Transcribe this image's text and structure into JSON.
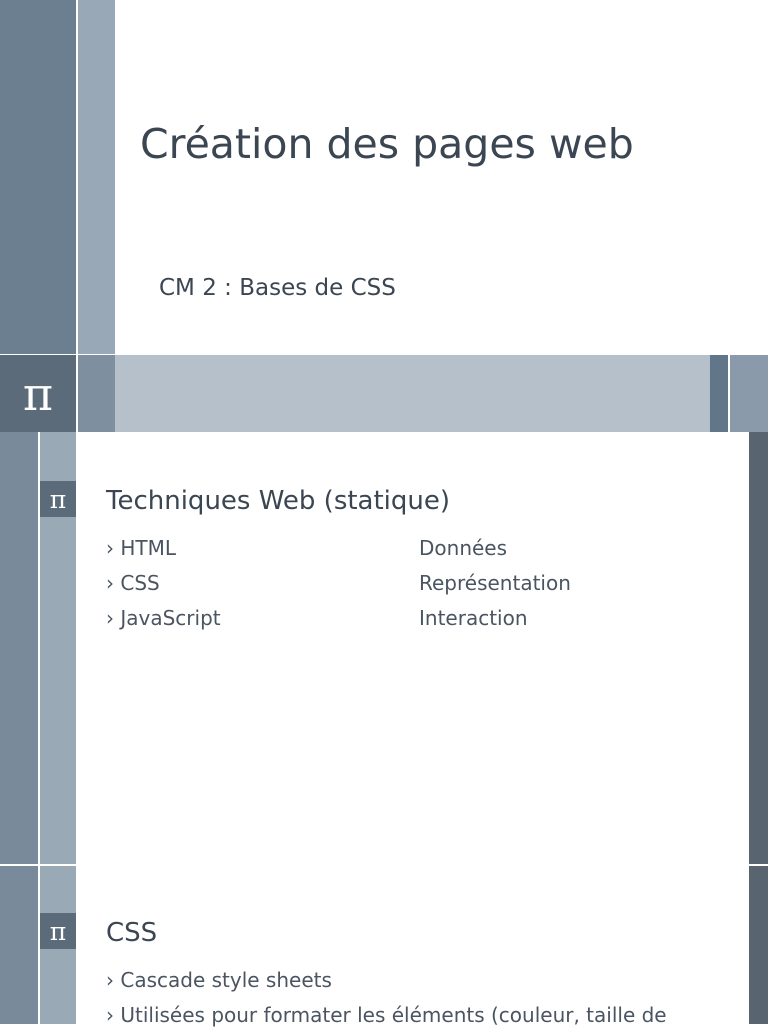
{
  "title_slide": {
    "title": "Création des pages web",
    "subtitle": "CM 2 : Bases de CSS",
    "pi_symbol": "π"
  },
  "slide1": {
    "pi_symbol": "π",
    "heading": "Techniques Web (statique)",
    "rows": [
      {
        "bullet": "› HTML",
        "desc": "Données"
      },
      {
        "bullet": "› CSS",
        "desc": "Représentation"
      },
      {
        "bullet": "› JavaScript",
        "desc": "Interaction"
      }
    ]
  },
  "slide2": {
    "pi_symbol": "π",
    "heading": "CSS",
    "bullets": [
      "› Cascade style sheets",
      "› Utilisées pour formater les éléments (couleur, taille de"
    ]
  },
  "colors": {
    "sidebar_dark": "#6b7f91",
    "sidebar_light": "#98a8b6",
    "band": "#b6c0ca",
    "pi_box": "#5b6b7a",
    "right_bar": "#58646f",
    "text": "#3b4652"
  }
}
